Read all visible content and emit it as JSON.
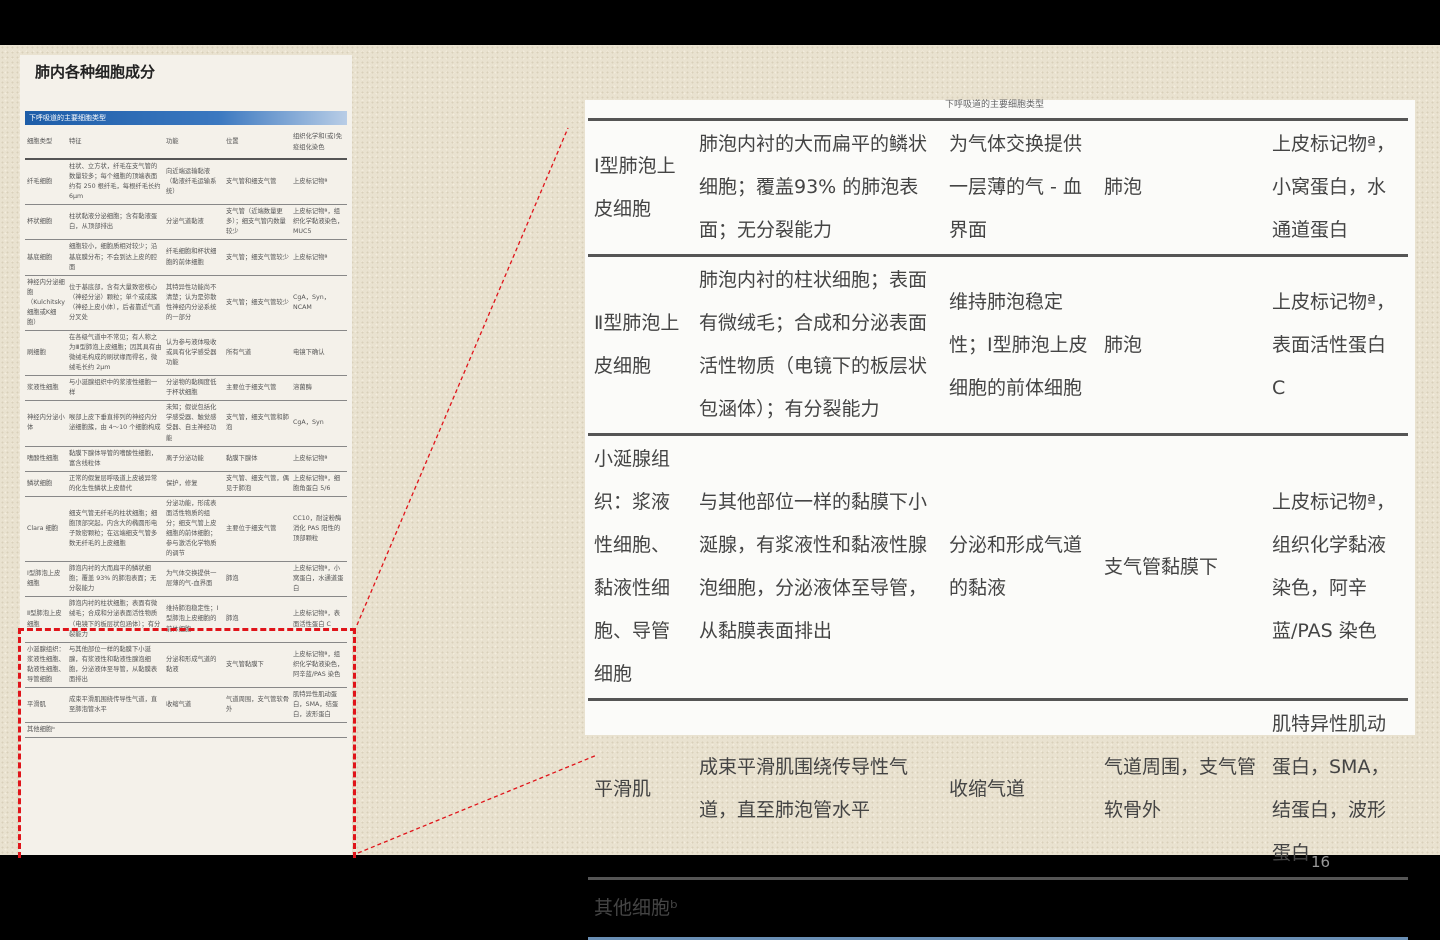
{
  "slide": {
    "title": "肺内各种细胞成分",
    "page_number": "16"
  },
  "left_table": {
    "caption": "下呼吸道的主要细胞类型",
    "headers": [
      "细胞类型",
      "特征",
      "功能",
      "位置",
      "组织化学和(或)免疫组化染色"
    ],
    "rows": [
      [
        "纤毛细胞",
        "柱状、立方状，纤毛在支气管的数量较多；每个细胞的顶端表面约有 250 根纤毛，每根纤毛长约 6μm",
        "向近端运输黏液（黏液纤毛运输系统）",
        "支气管和细支气管",
        "上皮标记物ª"
      ],
      [
        "杯状细胞",
        "柱状黏液分泌细胞；含有黏液蛋白，从顶部排出",
        "分泌气道黏液",
        "支气管（近端数量更多）；细支气管内数量较少",
        "上皮标记物ª，组织化学黏液染色，MUC5"
      ],
      [
        "基底细胞",
        "细胞较小，细胞质相对较少；沿基底膜分布；不会到达上皮的腔面",
        "纤毛细胞和杯状细胞的前体细胞",
        "支气管；细支气管较少",
        "上皮标记物ª"
      ],
      [
        "神经内分泌细胞（Kulchitsky 细胞或K细胞）",
        "位于基底部，含有大量致密核心（神经分泌）颗粒；单个或成簇（神经上皮小体），后者靠近气道分叉处",
        "其特异性功能尚不清楚；认为是弥散性神经内分泌系统的一部分",
        "支气管；细支气管较少",
        "CgA，Syn，NCAM"
      ],
      [
        "刷细胞",
        "在各级气道中不常见；有人称之为Ⅲ型肺泡上皮细胞；因其具有由微绒毛构成的刷状缘而得名，微绒毛长约 2μm",
        "认为参与液体吸收或具有化学感受器功能",
        "所有气道",
        "电镜下确认"
      ],
      [
        "浆液性细胞",
        "与小涎腺组织中的浆液性细胞一样",
        "分泌物的黏稠度低于杯状细胞",
        "主要位于细支气管",
        "溶菌酶"
      ],
      [
        "神经内分泌小体",
        "喉部上皮下垂直排列的神经内分泌细胞簇，由 4～10 个细胞构成",
        "未知；假说包括化学感受器、触觉感受器、自主神经功能",
        "支气管，细支气管和肺泡",
        "CgA，Syn"
      ],
      [
        "嗜酸性细胞",
        "黏膜下腺体导管的嗜酸性细胞，富含线粒体",
        "离子分泌功能",
        "黏膜下腺体",
        "上皮标记物ª"
      ],
      [
        "鳞状细胞",
        "正常的假复层呼吸道上皮被异常的化生性鳞状上皮替代",
        "保护，修复",
        "支气管、细支气管，偶见于肺泡",
        "上皮标记物ª，细胞角蛋白 5/6"
      ],
      [
        "Clara 细胞",
        "细支气管无纤毛的柱状细胞；细胞顶部突起，内含大的椭圆形电子致密颗粒；在远端细支气管多数无纤毛的上皮细胞",
        "分泌功能，形成表面活性物质的组分；细支气管上皮细胞的前体细胞；参与激活化学物质的调节",
        "主要位于细支气管",
        "CC10，耐淀粉酶消化 PAS 阳性的顶部颗粒"
      ],
      [
        "Ⅰ型肺泡上皮细胞",
        "肺泡内衬的大而扁平的鳞状细胞；覆盖 93% 的肺泡表面；无分裂能力",
        "为气体交换提供一层薄的气-血界面",
        "肺泡",
        "上皮标记物ª，小窝蛋白，水通道蛋白"
      ],
      [
        "Ⅱ型肺泡上皮细胞",
        "肺泡内衬的柱状细胞；表面有微绒毛；合成和分泌表面活性物质（电镜下的板层状包涵体）；有分裂能力",
        "维持肺泡稳定性；Ⅰ型肺泡上皮细胞的前体细胞",
        "肺泡",
        "上皮标记物ª，表面活性蛋白 C"
      ],
      [
        "小涎腺组织：浆液性细胞、黏液性细胞、导管细胞",
        "与其他部位一样的黏膜下小涎腺，有浆液性和黏液性腺泡细胞，分泌液体至导管，从黏膜表面排出",
        "分泌和形成气道的黏液",
        "支气管黏膜下",
        "上皮标记物ª，组织化学黏液染色，阿辛蓝/PAS 染色"
      ],
      [
        "平滑肌",
        "成束平滑肌围绕传导性气道，直至肺泡管水平",
        "收缩气道",
        "气道周围，支气管软骨外",
        "肌特异性肌动蛋白，SMA，结蛋白，波形蛋白"
      ],
      [
        "其他细胞ᵇ",
        "",
        "",
        "",
        ""
      ]
    ]
  },
  "right_table": {
    "caption": "下呼吸道的主要细胞类型",
    "rows": [
      [
        "Ⅰ型肺泡上皮细胞",
        "肺泡内衬的大而扁平的鳞状细胞；覆盖93% 的肺泡表面；无分裂能力",
        "为气体交换提供一层薄的气 - 血界面",
        "肺泡",
        "上皮标记物ª，小窝蛋白，水通道蛋白"
      ],
      [
        "Ⅱ型肺泡上皮细胞",
        "肺泡内衬的柱状细胞；表面有微绒毛；合成和分泌表面活性物质（电镜下的板层状包涵体）；有分裂能力",
        "维持肺泡稳定性；Ⅰ型肺泡上皮细胞的前体细胞",
        "肺泡",
        "上皮标记物ª，表面活性蛋白 C"
      ],
      [
        "小涎腺组织：浆液性细胞、黏液性细胞、导管细胞",
        "与其他部位一样的黏膜下小涎腺，有浆液性和黏液性腺泡细胞，分泌液体至导管，从黏膜表面排出",
        "分泌和形成气道的黏液",
        "支气管黏膜下",
        "上皮标记物ª，组织化学黏液染色，阿辛蓝/PAS 染色"
      ],
      [
        "平滑肌",
        "成束平滑肌围绕传导性气道，直至肺泡管水平",
        "收缩气道",
        "气道周围，支气管软骨外",
        "肌特异性肌动蛋白，SMA，结蛋白，波形蛋白"
      ],
      [
        "其他细胞ᵇ",
        "",
        "",
        "",
        ""
      ]
    ]
  },
  "colors": {
    "highlight": "#e0141a",
    "caption_bar": "#1d5da8"
  }
}
